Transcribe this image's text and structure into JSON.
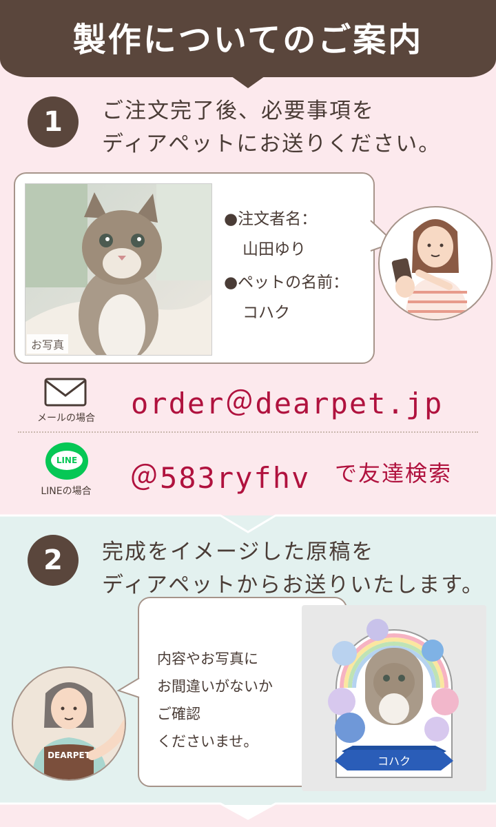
{
  "banner": {
    "title": "製作についてのご案内"
  },
  "step1": {
    "number": "1",
    "line1": "ご注文完了後、必要事項を",
    "line2": "ディアペットにお送りください。",
    "photo_label": "お写真",
    "info": {
      "order_name_label": "●注文者名：",
      "order_name": "山田ゆり",
      "pet_name_label": "●ペットの名前：",
      "pet_name": "コハク"
    }
  },
  "contact": {
    "mail_label": "メールの場合",
    "mail_address": "order＠dearpet.jp",
    "line_icon_text": "LINE",
    "line_label": "LINEの場合",
    "line_id": "＠583ryfhv",
    "line_suffix": "で友達検索"
  },
  "step2": {
    "number": "2",
    "line1": "完成をイメージした原稿を",
    "line2": "ディアペットからお送りいたします。",
    "bubble_lines": [
      "内容やお写真に",
      "お間違いがないか",
      "ご確認",
      "くださいませ。"
    ],
    "staff_apron": "DEARPET",
    "sample_name": "コハク"
  },
  "colors": {
    "brown": "#5a463c",
    "pink_bg": "#fce9ed",
    "mint_bg": "#e3f1ef",
    "crimson": "#b0123e",
    "line_green": "#06c755"
  }
}
